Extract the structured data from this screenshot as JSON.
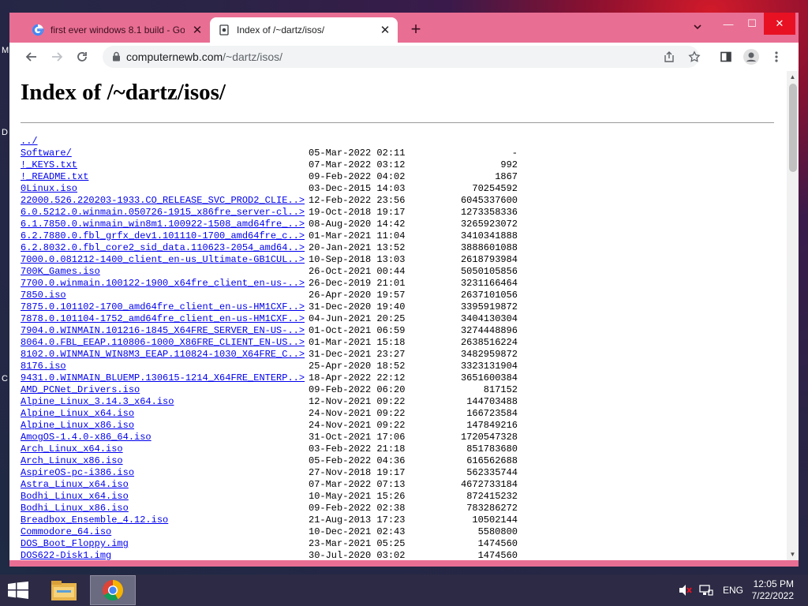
{
  "desktop": {
    "edge_letters": [
      "M",
      "D",
      "C"
    ]
  },
  "browser": {
    "tabs": [
      {
        "title": "first ever windows 8.1 build - Go",
        "favicon": "google-icon",
        "active": false
      },
      {
        "title": "Index of /~dartz/isos/",
        "favicon": "page-icon",
        "active": true
      }
    ],
    "new_tab_label": "+",
    "window_controls": {
      "minimize": "—",
      "maximize": "☐",
      "close": "✕"
    },
    "toolbar": {
      "url_host": "computernewb.com",
      "url_path": "/~dartz/isos/"
    }
  },
  "page": {
    "title": "Index of /~dartz/isos/",
    "entries": [
      {
        "name": "../",
        "date": "",
        "size": ""
      },
      {
        "name": "Software/",
        "date": "05-Mar-2022 02:11",
        "size": "-"
      },
      {
        "name": "!_KEYS.txt",
        "date": "07-Mar-2022 03:12",
        "size": "992"
      },
      {
        "name": "!_README.txt",
        "date": "09-Feb-2022 04:02",
        "size": "1867"
      },
      {
        "name": "0Linux.iso",
        "date": "03-Dec-2015 14:03",
        "size": "70254592"
      },
      {
        "name": "22000.526.220203-1933.CO_RELEASE_SVC_PROD2_CLIE..>",
        "date": "12-Feb-2022 23:56",
        "size": "6045337600"
      },
      {
        "name": "6.0.5212.0.winmain.050726-1915_x86fre_server-cl..>",
        "date": "19-Oct-2018 19:17",
        "size": "1273358336"
      },
      {
        "name": "6.1.7850.0.winmain_win8m1.100922-1508_amd64fre_..>",
        "date": "08-Aug-2020 14:42",
        "size": "3265923072"
      },
      {
        "name": "6.2.7880.0.fbl_grfx_dev1.101110-1700_amd64fre_c..>",
        "date": "01-Mar-2021 11:04",
        "size": "3410341888"
      },
      {
        "name": "6.2.8032.0.fbl_core2_sid_data.110623-2054_amd64..>",
        "date": "20-Jan-2021 13:52",
        "size": "3888601088"
      },
      {
        "name": "7000.0.081212-1400_client_en-us_Ultimate-GB1CUL..>",
        "date": "10-Sep-2018 13:03",
        "size": "2618793984"
      },
      {
        "name": "700K_Games.iso",
        "date": "26-Oct-2021 00:44",
        "size": "5050105856"
      },
      {
        "name": "7700.0.winmain.100122-1900_x64fre_client_en-us-..>",
        "date": "26-Dec-2019 21:01",
        "size": "3231166464"
      },
      {
        "name": "7850.iso",
        "date": "26-Apr-2020 19:57",
        "size": "2637101056"
      },
      {
        "name": "7875.0.101102-1700_amd64fre_client_en-us-HM1CXF..>",
        "date": "31-Dec-2020 19:40",
        "size": "3395919872"
      },
      {
        "name": "7878.0.101104-1752_amd64fre_client_en-us-HM1CXF..>",
        "date": "04-Jun-2021 20:25",
        "size": "3404130304"
      },
      {
        "name": "7904.0.WINMAIN.101216-1845_X64FRE_SERVER_EN-US-..>",
        "date": "01-Oct-2021 06:59",
        "size": "3274448896"
      },
      {
        "name": "8064.0.FBL_EEAP.110806-1000_X86FRE_CLIENT_EN-US..>",
        "date": "01-Mar-2021 15:18",
        "size": "2638516224"
      },
      {
        "name": "8102.0.WINMAIN_WIN8M3_EEAP.110824-1030_X64FRE_C..>",
        "date": "31-Dec-2021 23:27",
        "size": "3482959872"
      },
      {
        "name": "8176.iso",
        "date": "25-Apr-2020 18:52",
        "size": "3323131904"
      },
      {
        "name": "9431.0.WINMAIN_BLUEMP.130615-1214_X64FRE_ENTERP..>",
        "date": "18-Apr-2022 22:12",
        "size": "3651600384"
      },
      {
        "name": "AMD_PCNet_Drivers.iso",
        "date": "09-Feb-2022 06:20",
        "size": "817152"
      },
      {
        "name": "Alpine_Linux_3.14.3_x64.iso",
        "date": "12-Nov-2021 09:22",
        "size": "144703488"
      },
      {
        "name": "Alpine_Linux_x64.iso",
        "date": "24-Nov-2021 09:22",
        "size": "166723584"
      },
      {
        "name": "Alpine_Linux_x86.iso",
        "date": "24-Nov-2021 09:22",
        "size": "147849216"
      },
      {
        "name": "AmogOS-1.4.0-x86_64.iso",
        "date": "31-Oct-2021 17:06",
        "size": "1720547328"
      },
      {
        "name": "Arch_Linux_x64.iso",
        "date": "03-Feb-2022 21:18",
        "size": "851783680"
      },
      {
        "name": "Arch_Linux_x86.iso",
        "date": "05-Feb-2022 04:36",
        "size": "616562688"
      },
      {
        "name": "AspireOS-pc-i386.iso",
        "date": "27-Nov-2018 19:17",
        "size": "562335744"
      },
      {
        "name": "Astra_Linux_x64.iso",
        "date": "07-Mar-2022 07:13",
        "size": "4672733184"
      },
      {
        "name": "Bodhi_Linux_x64.iso",
        "date": "10-May-2021 15:26",
        "size": "872415232"
      },
      {
        "name": "Bodhi_Linux_x86.iso",
        "date": "09-Feb-2022 02:38",
        "size": "783286272"
      },
      {
        "name": "Breadbox_Ensemble_4.12.iso",
        "date": "21-Aug-2013 17:23",
        "size": "10502144"
      },
      {
        "name": "Commodore_64.iso",
        "date": "10-Dec-2021 02:43",
        "size": "5580800"
      },
      {
        "name": "DOS_Boot_Floppy.img",
        "date": "23-Mar-2021 05:25",
        "size": "1474560"
      },
      {
        "name": "DOS622-Disk1.img",
        "date": "30-Jul-2020 03:02",
        "size": "1474560"
      }
    ]
  },
  "taskbar": {
    "language": "ENG",
    "time": "12:05 PM",
    "date": "7/22/2022"
  },
  "colors": {
    "chrome_frame": "#e96e93",
    "link": "#0000ee",
    "taskbar": "#2c2a44"
  }
}
